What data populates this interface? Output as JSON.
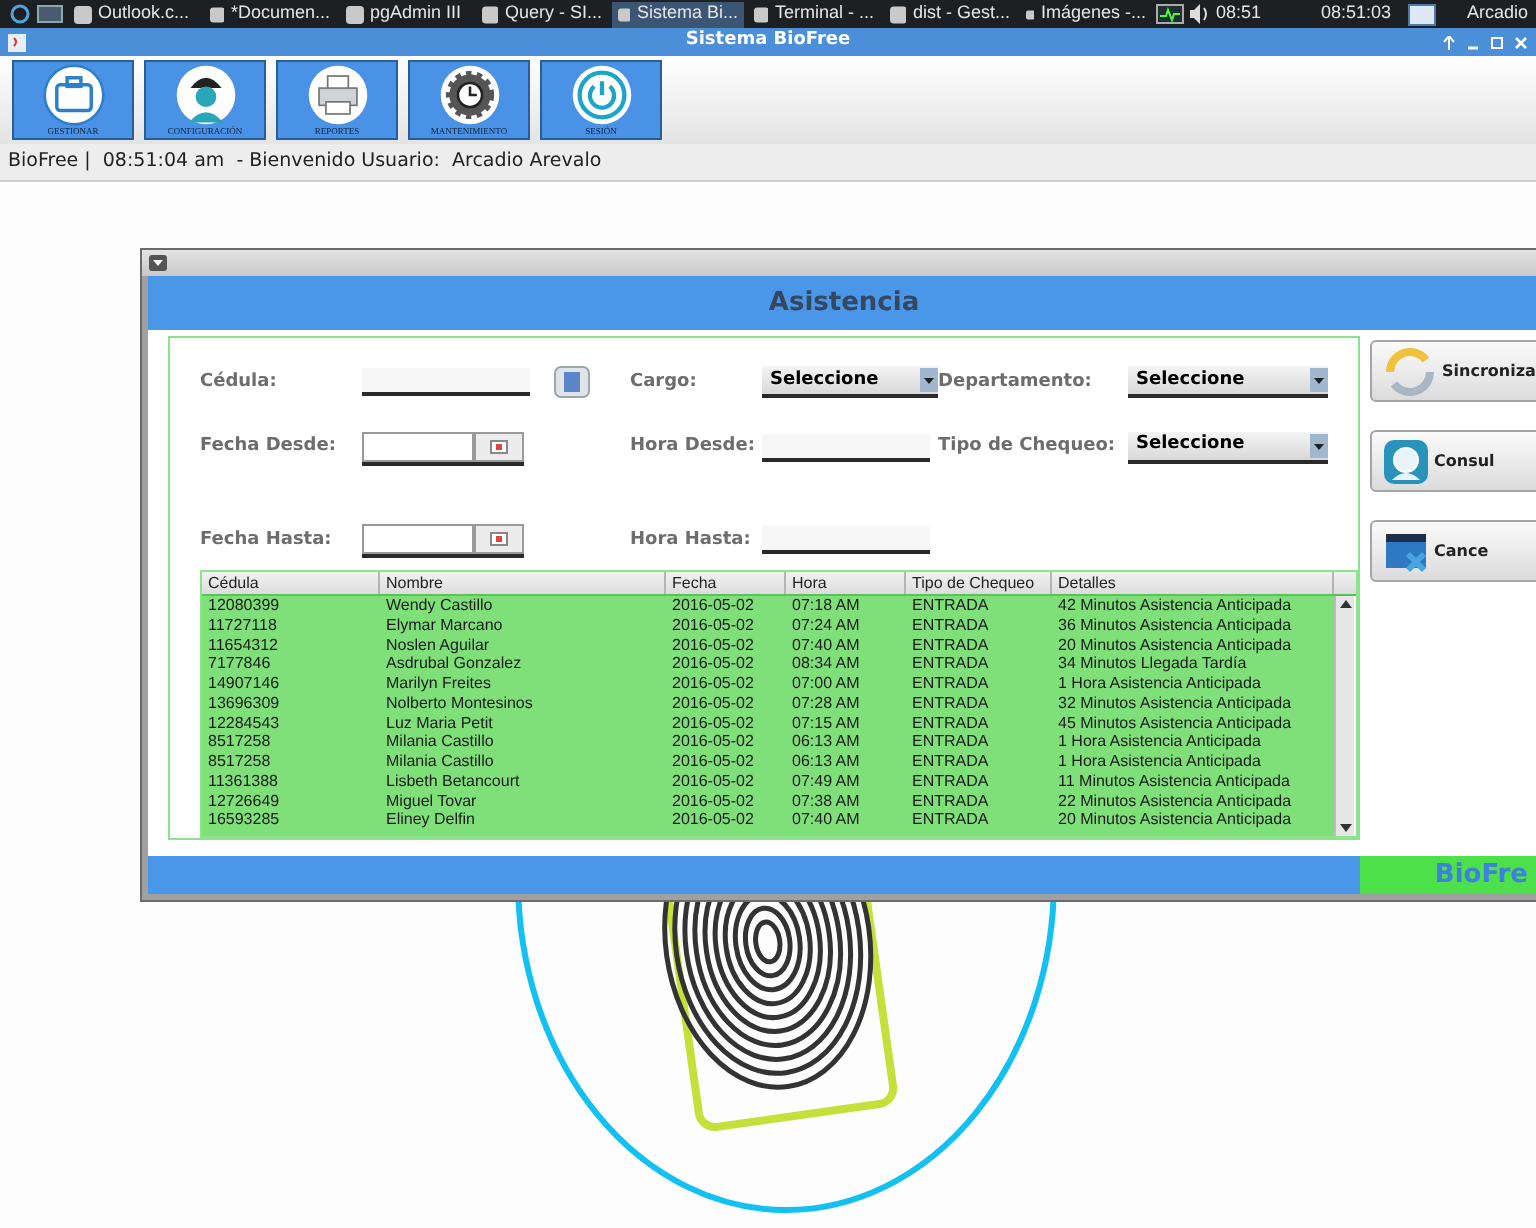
{
  "taskbar": {
    "items": [
      {
        "label": "Outlook.c...",
        "selected": false
      },
      {
        "label": "*Documen...",
        "selected": false
      },
      {
        "label": "pgAdmin III",
        "selected": false
      },
      {
        "label": "Query - SI...",
        "selected": false
      },
      {
        "label": "Sistema Bi...",
        "selected": true
      },
      {
        "label": "Terminal - ...",
        "selected": false
      },
      {
        "label": "dist - Gest...",
        "selected": false
      },
      {
        "label": "Imágenes -...",
        "selected": false
      }
    ],
    "clock": "08:51",
    "clock_2": "08:51:03",
    "user": "Arcadio"
  },
  "main_window": {
    "title": "Sistema BioFree",
    "toolbar": [
      {
        "label": "GESTIONAR",
        "kind": "briefcase"
      },
      {
        "label": "CONFIGURACIÓN",
        "kind": "worker"
      },
      {
        "label": "REPORTES",
        "kind": "printer"
      },
      {
        "label": "MANTENIMIENTO",
        "kind": "gear"
      },
      {
        "label": "SESIÓN",
        "kind": "power"
      }
    ],
    "status": "BioFree |  08:51:04 am  - Bienvenido Usuario:  Arcadio Arevalo"
  },
  "asistencia": {
    "title": "Asistencia",
    "form_rows": [
      [
        {
          "label": "Cédula:",
          "kind": "text",
          "icon": true
        },
        {
          "label": "Cargo:",
          "kind": "select",
          "value": "Seleccione"
        },
        {
          "label": "Departamento:",
          "kind": "select",
          "value": "Seleccione"
        }
      ],
      [
        {
          "label": "Fecha Desde:",
          "kind": "date"
        },
        {
          "label": "Hora Desde:",
          "kind": "text"
        },
        {
          "label": "Tipo de Chequeo:",
          "kind": "select",
          "value": "Seleccione"
        }
      ],
      [
        {
          "label": "Fecha Hasta:",
          "kind": "date"
        },
        {
          "label": "Hora Hasta:",
          "kind": "text"
        }
      ]
    ],
    "table": {
      "columns": [
        "Cédula",
        "Nombre",
        "Fecha",
        "Hora",
        "Tipo de Chequeo",
        "Detalles"
      ],
      "rows": [
        [
          "12080399",
          "Wendy Castillo",
          "2016-05-02",
          "07:18 AM",
          "ENTRADA",
          "42 Minutos  Asistencia Anticipada"
        ],
        [
          "11727118",
          "Elymar Marcano",
          "2016-05-02",
          "07:24 AM",
          "ENTRADA",
          "36 Minutos  Asistencia Anticipada"
        ],
        [
          "11654312",
          "Noslen Aguilar",
          "2016-05-02",
          "07:40 AM",
          "ENTRADA",
          "20 Minutos  Asistencia Anticipada"
        ],
        [
          "7177846",
          "Asdrubal Gonzalez",
          "2016-05-02",
          "08:34 AM",
          "ENTRADA",
          "34 Minutos  Llegada Tardía"
        ],
        [
          "14907146",
          "Marilyn Freites",
          "2016-05-02",
          "07:00 AM",
          "ENTRADA",
          "1 Hora  Asistencia Anticipada"
        ],
        [
          "13696309",
          "Nolberto Montesinos",
          "2016-05-02",
          "07:28 AM",
          "ENTRADA",
          "32 Minutos  Asistencia Anticipada"
        ],
        [
          "12284543",
          "Luz Maria Petit",
          "2016-05-02",
          "07:15 AM",
          "ENTRADA",
          "45 Minutos  Asistencia Anticipada"
        ],
        [
          "8517258",
          "Milania Castillo",
          "2016-05-02",
          "06:13 AM",
          "ENTRADA",
          "1 Hora  Asistencia Anticipada"
        ],
        [
          "8517258",
          "Milania Castillo",
          "2016-05-02",
          "06:13 AM",
          "ENTRADA",
          "1 Hora  Asistencia Anticipada"
        ],
        [
          "11361388",
          "Lisbeth Betancourt",
          "2016-05-02",
          "07:49 AM",
          "ENTRADA",
          "11 Minutos  Asistencia Anticipada"
        ],
        [
          "12726649",
          "Miguel Tovar",
          "2016-05-02",
          "07:38 AM",
          "ENTRADA",
          "22 Minutos  Asistencia Anticipada"
        ],
        [
          "16593285",
          "Eliney Delfin",
          "2016-05-02",
          "07:40 AM",
          "ENTRADA",
          "20 Minutos  Asistencia Anticipada"
        ]
      ]
    },
    "actions": [
      {
        "label": "Sincroniza",
        "kind": "sync"
      },
      {
        "label": "Consul",
        "kind": "search"
      },
      {
        "label": "Cance",
        "kind": "cancel"
      }
    ],
    "footer": "BioFre"
  }
}
